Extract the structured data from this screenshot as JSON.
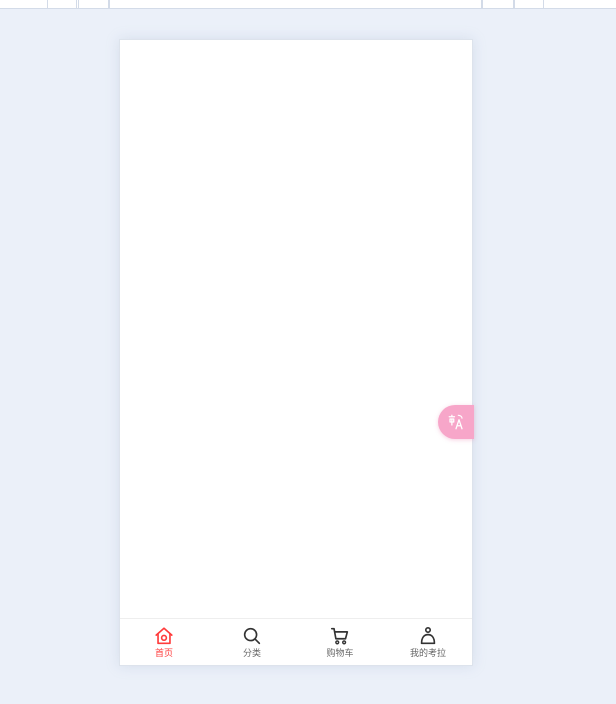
{
  "tabbar": {
    "items": [
      {
        "label": "首页",
        "icon": "home-icon",
        "active": true
      },
      {
        "label": "分类",
        "icon": "search-icon",
        "active": false
      },
      {
        "label": "购物车",
        "icon": "cart-icon",
        "active": false
      },
      {
        "label": "我的考拉",
        "icon": "user-icon",
        "active": false
      }
    ]
  },
  "translate_button": {
    "icon": "translate-icon"
  },
  "colors": {
    "page_background": "#ebf0f9",
    "active_tab": "#ff3b3b",
    "inactive_tab": "#666666",
    "translate_button": "#f7a6c9"
  }
}
